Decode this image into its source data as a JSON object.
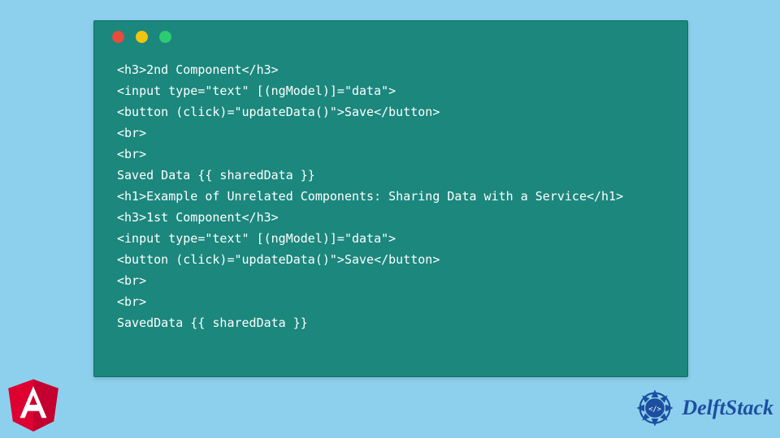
{
  "code_lines": [
    "<h3>2nd Component</h3>",
    "<input type=\"text\" [(ngModel)]=\"data\">",
    "<button (click)=\"updateData()\">Save</button>",
    "<br>",
    "<br>",
    "Saved Data {{ sharedData }}",
    "<h1>Example of Unrelated Components: Sharing Data with a Service</h1>",
    "<h3>1st Component</h3>",
    "<input type=\"text\" [(ngModel)]=\"data\">",
    "<button (click)=\"updateData()\">Save</button>",
    "<br>",
    "<br>",
    "SavedData {{ sharedData }}"
  ],
  "brand": {
    "name": "DelftStack"
  }
}
